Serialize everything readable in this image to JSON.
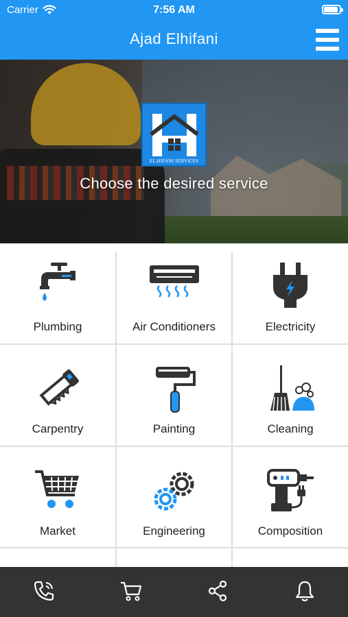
{
  "status_bar": {
    "carrier": "Carrier",
    "time": "7:56 AM"
  },
  "header": {
    "title": "Ajad Elhifani",
    "menu_icon": "hamburger-menu-icon"
  },
  "hero": {
    "logo_caption": "EL.HIFANI SERVICES",
    "tagline": "Choose the desired service"
  },
  "colors": {
    "primary": "#2196f3",
    "icon_dark": "#333333",
    "accent": "#1e88e5",
    "tab_bar": "#333333"
  },
  "services": [
    {
      "label": "Plumbing",
      "icon": "faucet-icon"
    },
    {
      "label": "Air Conditioners",
      "icon": "air-conditioner-icon"
    },
    {
      "label": "Electricity",
      "icon": "electric-plug-icon"
    },
    {
      "label": "Carpentry",
      "icon": "saw-icon"
    },
    {
      "label": "Painting",
      "icon": "paint-roller-icon"
    },
    {
      "label": "Cleaning",
      "icon": "broom-icon"
    },
    {
      "label": "Market",
      "icon": "shopping-cart-icon"
    },
    {
      "label": "Engineering",
      "icon": "gears-icon"
    },
    {
      "label": "Composition",
      "icon": "drill-icon"
    }
  ],
  "tab_bar": [
    {
      "icon": "phone-icon"
    },
    {
      "icon": "cart-icon"
    },
    {
      "icon": "share-icon"
    },
    {
      "icon": "bell-icon"
    }
  ]
}
